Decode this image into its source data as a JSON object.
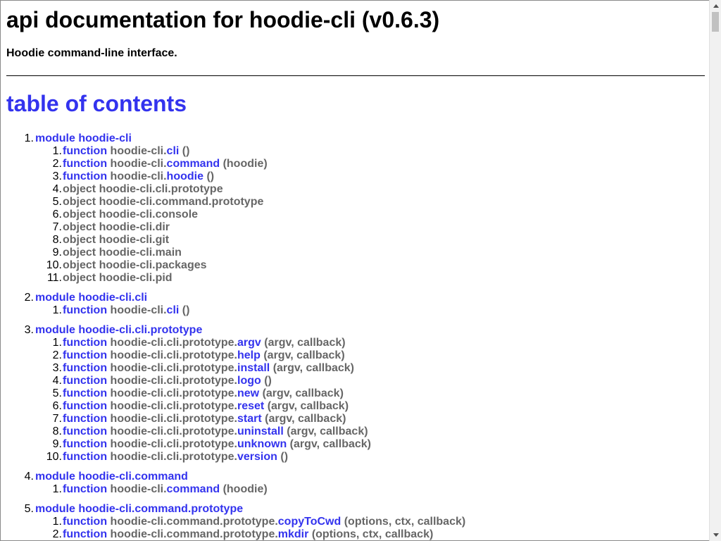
{
  "page": {
    "title": "api documentation for hoodie-cli (v0.6.3)",
    "description": "Hoodie command-line interface.",
    "toc_heading": "table of contents"
  },
  "colors": {
    "link": "#3333ee",
    "muted": "#666666"
  },
  "modules": [
    {
      "num": "1.",
      "label": "module hoodie-cli",
      "items": [
        {
          "num": "1.",
          "kind": "function",
          "prefix": "hoodie-cli.",
          "name": "cli",
          "args": "()"
        },
        {
          "num": "2.",
          "kind": "function",
          "prefix": "hoodie-cli.",
          "name": "command",
          "args": "(hoodie)"
        },
        {
          "num": "3.",
          "kind": "function",
          "prefix": "hoodie-cli.",
          "name": "hoodie",
          "args": "()"
        },
        {
          "num": "4.",
          "kind": "object",
          "prefix": "hoodie-cli.cli.prototype",
          "name": "",
          "args": ""
        },
        {
          "num": "5.",
          "kind": "object",
          "prefix": "hoodie-cli.command.prototype",
          "name": "",
          "args": ""
        },
        {
          "num": "6.",
          "kind": "object",
          "prefix": "hoodie-cli.console",
          "name": "",
          "args": ""
        },
        {
          "num": "7.",
          "kind": "object",
          "prefix": "hoodie-cli.dir",
          "name": "",
          "args": ""
        },
        {
          "num": "8.",
          "kind": "object",
          "prefix": "hoodie-cli.git",
          "name": "",
          "args": ""
        },
        {
          "num": "9.",
          "kind": "object",
          "prefix": "hoodie-cli.main",
          "name": "",
          "args": ""
        },
        {
          "num": "10.",
          "kind": "object",
          "prefix": "hoodie-cli.packages",
          "name": "",
          "args": ""
        },
        {
          "num": "11.",
          "kind": "object",
          "prefix": "hoodie-cli.pid",
          "name": "",
          "args": ""
        }
      ]
    },
    {
      "num": "2.",
      "label": "module hoodie-cli.cli",
      "items": [
        {
          "num": "1.",
          "kind": "function",
          "prefix": "hoodie-cli.",
          "name": "cli",
          "args": "()"
        }
      ]
    },
    {
      "num": "3.",
      "label": "module hoodie-cli.cli.prototype",
      "items": [
        {
          "num": "1.",
          "kind": "function",
          "prefix": "hoodie-cli.cli.prototype.",
          "name": "argv",
          "args": "(argv, callback)"
        },
        {
          "num": "2.",
          "kind": "function",
          "prefix": "hoodie-cli.cli.prototype.",
          "name": "help",
          "args": "(argv, callback)"
        },
        {
          "num": "3.",
          "kind": "function",
          "prefix": "hoodie-cli.cli.prototype.",
          "name": "install",
          "args": "(argv, callback)"
        },
        {
          "num": "4.",
          "kind": "function",
          "prefix": "hoodie-cli.cli.prototype.",
          "name": "logo",
          "args": "()"
        },
        {
          "num": "5.",
          "kind": "function",
          "prefix": "hoodie-cli.cli.prototype.",
          "name": "new",
          "args": "(argv, callback)"
        },
        {
          "num": "6.",
          "kind": "function",
          "prefix": "hoodie-cli.cli.prototype.",
          "name": "reset",
          "args": "(argv, callback)"
        },
        {
          "num": "7.",
          "kind": "function",
          "prefix": "hoodie-cli.cli.prototype.",
          "name": "start",
          "args": "(argv, callback)"
        },
        {
          "num": "8.",
          "kind": "function",
          "prefix": "hoodie-cli.cli.prototype.",
          "name": "uninstall",
          "args": "(argv, callback)"
        },
        {
          "num": "9.",
          "kind": "function",
          "prefix": "hoodie-cli.cli.prototype.",
          "name": "unknown",
          "args": "(argv, callback)"
        },
        {
          "num": "10.",
          "kind": "function",
          "prefix": "hoodie-cli.cli.prototype.",
          "name": "version",
          "args": "()"
        }
      ]
    },
    {
      "num": "4.",
      "label": "module hoodie-cli.command",
      "items": [
        {
          "num": "1.",
          "kind": "function",
          "prefix": "hoodie-cli.",
          "name": "command",
          "args": "(hoodie)"
        }
      ]
    },
    {
      "num": "5.",
      "label": "module hoodie-cli.command.prototype",
      "items": [
        {
          "num": "1.",
          "kind": "function",
          "prefix": "hoodie-cli.command.prototype.",
          "name": "copyToCwd",
          "args": "(options, ctx, callback)"
        },
        {
          "num": "2.",
          "kind": "function",
          "prefix": "hoodie-cli.command.prototype.",
          "name": "mkdir",
          "args": "(options, ctx, callback)"
        }
      ]
    }
  ]
}
